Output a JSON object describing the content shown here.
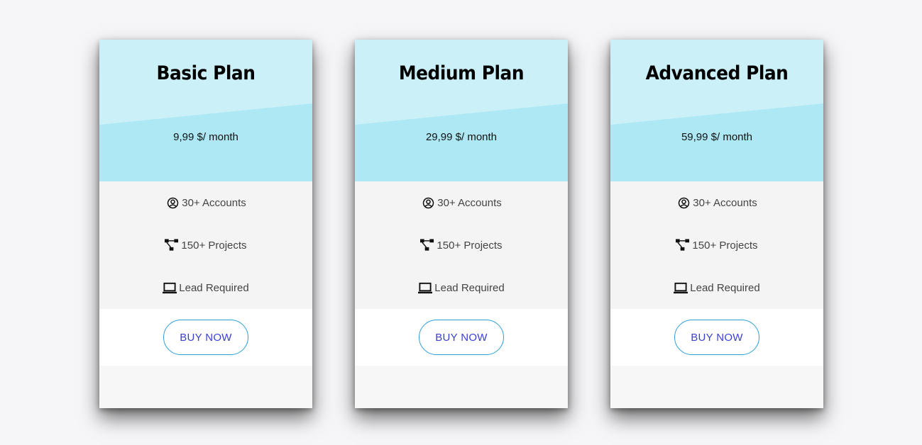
{
  "colors": {
    "header_light": "#ccf0f7",
    "header_dark": "#ade8f4",
    "features_bg": "#f4f4f4",
    "button_border": "#2b9fd6",
    "button_text": "#3a3fd0"
  },
  "plans": [
    {
      "title": "Basic Plan",
      "price": "9,99 $/ month",
      "features": [
        {
          "icon": "user-circle-icon",
          "label": "30+ Accounts"
        },
        {
          "icon": "project-network-icon",
          "label": "150+ Projects"
        },
        {
          "icon": "laptop-icon",
          "label": "Lead Required"
        }
      ],
      "button_label": "BUY NOW"
    },
    {
      "title": "Medium Plan",
      "price": "29,99 $/ month",
      "features": [
        {
          "icon": "user-circle-icon",
          "label": "30+ Accounts"
        },
        {
          "icon": "project-network-icon",
          "label": "150+ Projects"
        },
        {
          "icon": "laptop-icon",
          "label": "Lead Required"
        }
      ],
      "button_label": "BUY NOW"
    },
    {
      "title": "Advanced Plan",
      "price": "59,99 $/ month",
      "features": [
        {
          "icon": "user-circle-icon",
          "label": "30+ Accounts"
        },
        {
          "icon": "project-network-icon",
          "label": "150+ Projects"
        },
        {
          "icon": "laptop-icon",
          "label": "Lead Required"
        }
      ],
      "button_label": "BUY NOW"
    }
  ]
}
